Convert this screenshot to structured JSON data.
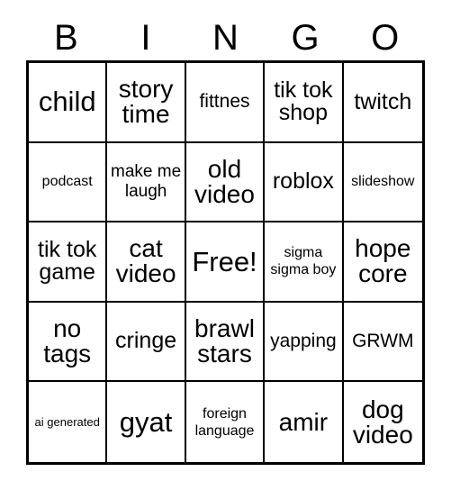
{
  "card": {
    "title": "BINGO",
    "header_letters": [
      "B",
      "I",
      "N",
      "G",
      "O"
    ],
    "free_space_label": "Free!",
    "rows": [
      [
        {
          "label": "child",
          "size": "xxl"
        },
        {
          "label": "story time",
          "size": "xl"
        },
        {
          "label": "fittnes",
          "size": "md"
        },
        {
          "label": "tik tok shop",
          "size": "lg"
        },
        {
          "label": "twitch",
          "size": "lg"
        }
      ],
      [
        {
          "label": "podcast",
          "size": "xs"
        },
        {
          "label": "make me laugh",
          "size": "sm"
        },
        {
          "label": "old video",
          "size": "xl"
        },
        {
          "label": "roblox",
          "size": "lg"
        },
        {
          "label": "slideshow",
          "size": "xs"
        }
      ],
      [
        {
          "label": "tik tok game",
          "size": "lg"
        },
        {
          "label": "cat video",
          "size": "xl"
        },
        {
          "label": "Free!",
          "size": "xxl"
        },
        {
          "label": "sigma sigma boy",
          "size": "xs"
        },
        {
          "label": "hope core",
          "size": "xl"
        }
      ],
      [
        {
          "label": "no tags",
          "size": "xl"
        },
        {
          "label": "cringe",
          "size": "lg"
        },
        {
          "label": "brawl stars",
          "size": "xl"
        },
        {
          "label": "yapping",
          "size": "md"
        },
        {
          "label": "GRWM",
          "size": "md"
        }
      ],
      [
        {
          "label": "ai generated",
          "size": "xxs"
        },
        {
          "label": "gyat",
          "size": "xxl"
        },
        {
          "label": "foreign language",
          "size": "xs"
        },
        {
          "label": "amir",
          "size": "xl"
        },
        {
          "label": "dog video",
          "size": "xl"
        }
      ]
    ]
  },
  "colors": {
    "ink": "#000000",
    "paper": "#ffffff"
  }
}
